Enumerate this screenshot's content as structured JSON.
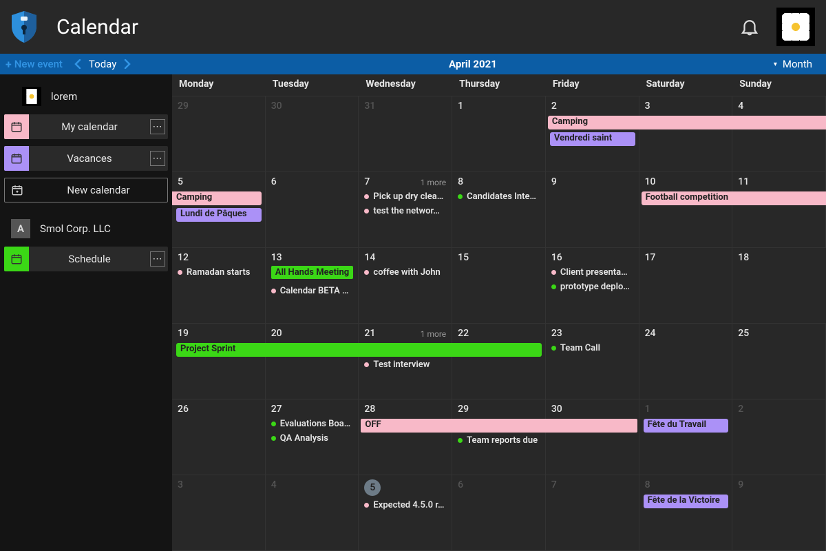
{
  "app": {
    "title": "Calendar"
  },
  "toolbar": {
    "new_event": "New event",
    "today": "Today",
    "period_label": "April 2021",
    "view_label": "Month"
  },
  "sidebar": {
    "user": {
      "name": "lorem"
    },
    "calendars": [
      {
        "label": "My calendar",
        "color": "#f8b9c8"
      },
      {
        "label": "Vacances",
        "color": "#ab91f7"
      }
    ],
    "new_calendar": "New calendar",
    "org": {
      "name": "Smol Corp. LLC",
      "initial": "A"
    },
    "org_calendars": [
      {
        "label": "Schedule",
        "color": "#3bd716"
      }
    ]
  },
  "colors": {
    "pink": "#f8b9c8",
    "green": "#3bd716",
    "purple": "#ab91f7"
  },
  "days_of_week": [
    "Monday",
    "Tuesday",
    "Wednesday",
    "Thursday",
    "Friday",
    "Saturday",
    "Sunday"
  ],
  "weeks": [
    {
      "days": [
        {
          "num": "29",
          "other": true
        },
        {
          "num": "30",
          "other": true
        },
        {
          "num": "31",
          "other": true
        },
        {
          "num": "1"
        },
        {
          "num": "2"
        },
        {
          "num": "3"
        },
        {
          "num": "4"
        }
      ],
      "spans": [
        {
          "label": "Camping",
          "color": "pink",
          "start": 4,
          "end": 7,
          "row": 0,
          "open_end": true
        },
        {
          "label": "Vendredi saint",
          "color": "purple",
          "start": 4,
          "end": 4,
          "row": 1,
          "boxed": true
        }
      ]
    },
    {
      "days": [
        {
          "num": "5"
        },
        {
          "num": "6"
        },
        {
          "num": "7",
          "more": "1 more"
        },
        {
          "num": "8"
        },
        {
          "num": "9"
        },
        {
          "num": "10"
        },
        {
          "num": "11"
        }
      ],
      "spans": [
        {
          "label": "Camping",
          "color": "pink",
          "start": 0,
          "end": 0,
          "row": 0,
          "open_start": true
        },
        {
          "label": "Lundi de Pâques",
          "color": "purple",
          "start": 0,
          "end": 0,
          "row": 1,
          "boxed": true
        },
        {
          "label": "Football competition",
          "color": "pink",
          "start": 5,
          "end": 6,
          "row": 0,
          "open_end": true
        }
      ],
      "dot_events": [
        {
          "day": 2,
          "color": "pink",
          "label": "Pick up dry clea…"
        },
        {
          "day": 2,
          "color": "pink",
          "label": "test the networ…"
        },
        {
          "day": 3,
          "color": "green",
          "label": "Candidates Inte…"
        }
      ]
    },
    {
      "days": [
        {
          "num": "12"
        },
        {
          "num": "13"
        },
        {
          "num": "14"
        },
        {
          "num": "15"
        },
        {
          "num": "16"
        },
        {
          "num": "17"
        },
        {
          "num": "18"
        }
      ],
      "dot_events": [
        {
          "day": 0,
          "color": "pink",
          "label": "Ramadan starts"
        },
        {
          "day": 1,
          "block": true,
          "color": "green",
          "label": "All Hands Meeting"
        },
        {
          "day": 1,
          "color": "pink",
          "label": "Calendar BETA …"
        },
        {
          "day": 2,
          "color": "pink",
          "label": "coffee with John"
        },
        {
          "day": 4,
          "color": "pink",
          "label": "Client presenta…"
        },
        {
          "day": 4,
          "color": "green",
          "label": "prototype deplo…"
        }
      ]
    },
    {
      "days": [
        {
          "num": "19"
        },
        {
          "num": "20"
        },
        {
          "num": "21",
          "more": "1 more"
        },
        {
          "num": "22"
        },
        {
          "num": "23"
        },
        {
          "num": "24"
        },
        {
          "num": "25"
        }
      ],
      "spans": [
        {
          "label": "Project Sprint",
          "color": "green",
          "start": 0,
          "end": 3,
          "row": 0,
          "boxed": true
        }
      ],
      "dot_events": [
        {
          "day": 2,
          "color": "pink",
          "label": "Test interview",
          "below_span": true
        },
        {
          "day": 4,
          "color": "green",
          "label": "Team Call"
        }
      ]
    },
    {
      "days": [
        {
          "num": "26"
        },
        {
          "num": "27"
        },
        {
          "num": "28"
        },
        {
          "num": "29"
        },
        {
          "num": "30"
        },
        {
          "num": "1",
          "other": true
        },
        {
          "num": "2",
          "other": true
        }
      ],
      "spans": [
        {
          "label": "OFF",
          "color": "pink",
          "start": 2,
          "end": 4,
          "row": 0
        },
        {
          "label": "Fête du Travail",
          "color": "purple",
          "start": 5,
          "end": 5,
          "row": 0,
          "boxed": true
        }
      ],
      "dot_events": [
        {
          "day": 1,
          "color": "green",
          "label": "Evaluations Boa…"
        },
        {
          "day": 1,
          "color": "green",
          "label": "QA Analysis"
        },
        {
          "day": 3,
          "color": "green",
          "label": "Team reports due",
          "below_span": true
        }
      ]
    },
    {
      "days": [
        {
          "num": "3",
          "other": true
        },
        {
          "num": "4",
          "other": true
        },
        {
          "num": "5",
          "other": true,
          "is_today": true
        },
        {
          "num": "6",
          "other": true
        },
        {
          "num": "7",
          "other": true
        },
        {
          "num": "8",
          "other": true
        },
        {
          "num": "9",
          "other": true
        }
      ],
      "spans": [
        {
          "label": "Fête de la Victoire",
          "color": "purple",
          "start": 5,
          "end": 5,
          "row": 0,
          "boxed": true
        }
      ],
      "dot_events": [
        {
          "day": 2,
          "color": "pink",
          "label": "Expected 4.5.0 r…"
        }
      ]
    }
  ]
}
